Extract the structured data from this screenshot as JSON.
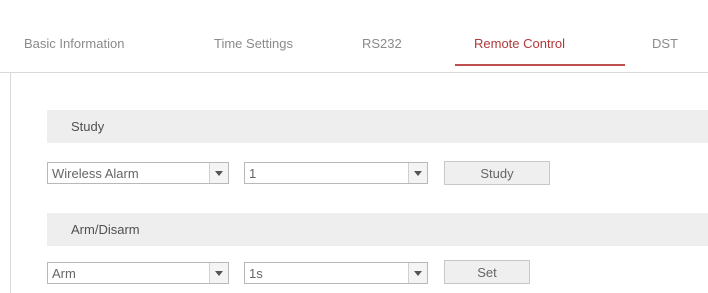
{
  "tabs": [
    {
      "label": "Basic Information",
      "active": false
    },
    {
      "label": "Time Settings",
      "active": false
    },
    {
      "label": "RS232",
      "active": false
    },
    {
      "label": "Remote Control",
      "active": true
    },
    {
      "label": "DST",
      "active": false
    }
  ],
  "study_section": {
    "title": "Study",
    "mode_select": {
      "value": "Wireless Alarm"
    },
    "number_select": {
      "value": "1"
    },
    "button_label": "Study"
  },
  "arm_section": {
    "title": "Arm/Disarm",
    "mode_select": {
      "value": "Arm"
    },
    "number_select": {
      "value": "1s"
    },
    "button_label": "Set"
  },
  "colors": {
    "active_tab": "#b03a3a",
    "underline": "#c0504d",
    "section_bg": "#eeeeee"
  }
}
